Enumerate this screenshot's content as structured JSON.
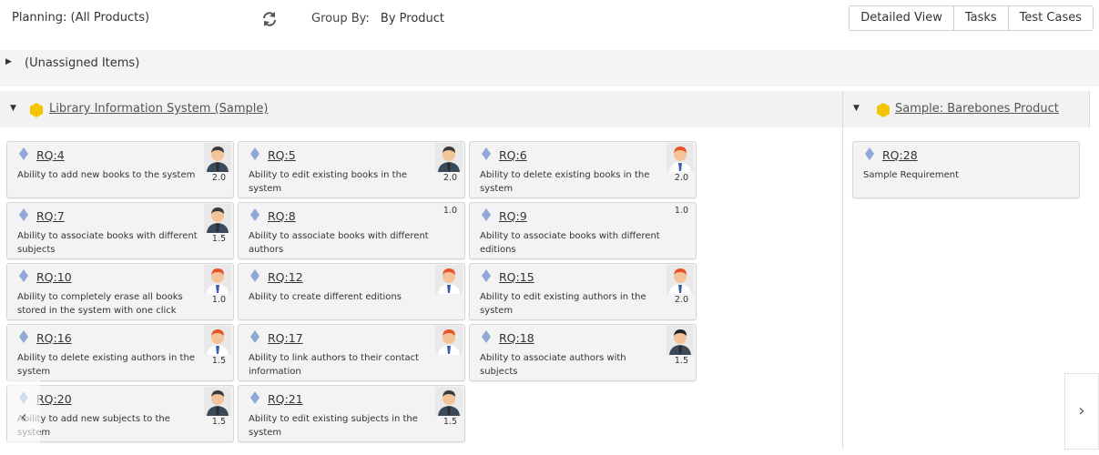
{
  "toolbar": {
    "planning_label": "Planning:",
    "planning_value": "(All Products)",
    "group_by_label": "Group By:",
    "group_by_value": "By Product",
    "views": [
      "Detailed View",
      "Tasks",
      "Test Cases"
    ]
  },
  "unassigned": {
    "label": "(Unassigned Items)"
  },
  "products": [
    {
      "name": "Library Information System (Sample)",
      "cards": [
        {
          "key": "RQ:4",
          "desc": "Ability to add new books to the system",
          "est": "2.0",
          "avatar": "man-dark"
        },
        {
          "key": "RQ:5",
          "desc": "Ability to edit existing books in the system",
          "est": "2.0",
          "avatar": "man-dark"
        },
        {
          "key": "RQ:6",
          "desc": "Ability to delete existing books in the system",
          "est": "2.0",
          "avatar": "man-red"
        },
        {
          "key": "RQ:7",
          "desc": "Ability to associate books with different subjects",
          "est": "1.5",
          "avatar": "man-dark"
        },
        {
          "key": "RQ:8",
          "desc": "Ability to associate books with different authors",
          "est": "1.0",
          "avatar": ""
        },
        {
          "key": "RQ:9",
          "desc": "Ability to associate books with different editions",
          "est": "1.0",
          "avatar": ""
        },
        {
          "key": "RQ:10",
          "desc": "Ability to completely erase all books stored in the system with one click",
          "est": "1.0",
          "avatar": "man-red"
        },
        {
          "key": "RQ:12",
          "desc": "Ability to create different editions",
          "est": "",
          "avatar": "man-red"
        },
        {
          "key": "RQ:15",
          "desc": "Ability to edit existing authors in the system",
          "est": "2.0",
          "avatar": "man-red"
        },
        {
          "key": "RQ:16",
          "desc": "Ability to delete existing authors in the system",
          "est": "1.5",
          "avatar": "man-red"
        },
        {
          "key": "RQ:17",
          "desc": "Ability to link authors to their contact information",
          "est": "",
          "avatar": "man-red"
        },
        {
          "key": "RQ:18",
          "desc": "Ability to associate authors with subjects",
          "est": "1.5",
          "avatar": "man-black"
        },
        {
          "key": "RQ:20",
          "desc": "Ability to add new subjects to the system",
          "est": "1.5",
          "avatar": "man-dark"
        },
        {
          "key": "RQ:21",
          "desc": "Ability to edit existing subjects in the system",
          "est": "1.5",
          "avatar": "man-dark"
        }
      ]
    },
    {
      "name": "Sample: Barebones Product",
      "cards": [
        {
          "key": "RQ:28",
          "desc": "Sample Requirement",
          "est": "",
          "avatar": ""
        }
      ]
    }
  ],
  "icons": {
    "refresh": "refresh-icon",
    "requirement": "diamond-icon",
    "product": "hexagon-icon",
    "prev": "chevron-left-icon",
    "next": "chevron-right-icon"
  },
  "colors": {
    "product_hex": "#f5c400",
    "requirement_gem": "#8fa9d6"
  }
}
